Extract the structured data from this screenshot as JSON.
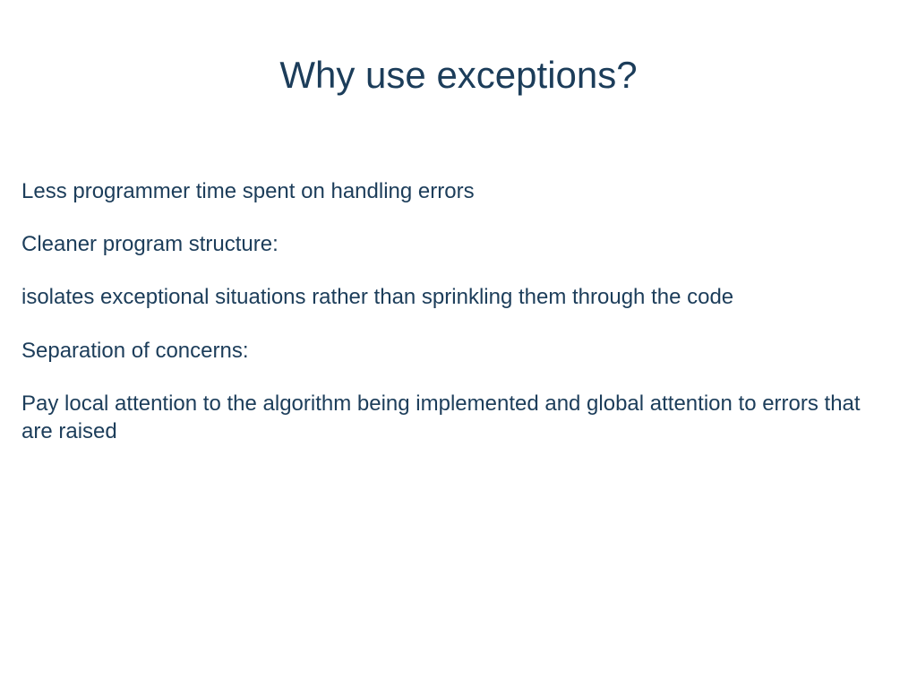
{
  "slide": {
    "title": "Why use exceptions?",
    "paragraphs": [
      "Less programmer time spent on handling errors",
      "Cleaner program structure:",
      "isolates exceptional situations rather than sprinkling them through the code",
      "Separation of concerns:",
      "Pay local attention to the algorithm being implemented and global attention to errors that are raised"
    ]
  }
}
